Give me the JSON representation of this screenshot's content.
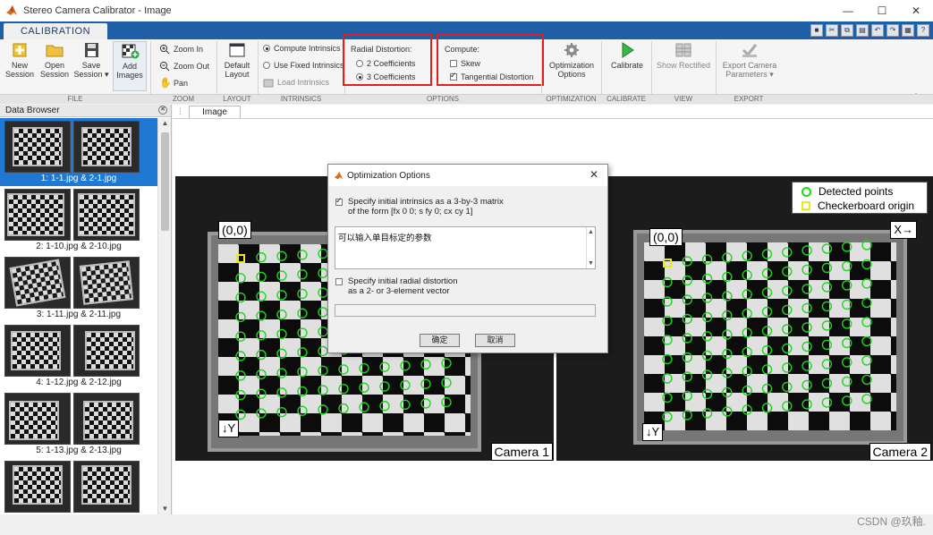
{
  "window": {
    "title": "Stereo Camera Calibrator - Image",
    "controls": [
      "—",
      "☐",
      "✕"
    ]
  },
  "tab": {
    "label": "CALIBRATION"
  },
  "ribbon": {
    "file": {
      "section": "FILE",
      "new_session": [
        "New",
        "Session"
      ],
      "open_session": [
        "Open",
        "Session"
      ],
      "save_session": [
        "Save",
        "Session ▾"
      ],
      "add_images": [
        "Add",
        "Images"
      ]
    },
    "zoom": {
      "section": "ZOOM",
      "zoom_in": "Zoom In",
      "zoom_out": "Zoom Out",
      "pan": "Pan"
    },
    "layout": {
      "section": "LAYOUT",
      "default_layout": [
        "Default",
        "Layout"
      ]
    },
    "intrinsics": {
      "section": "INTRINSICS",
      "compute": "Compute Intrinsics",
      "use_fixed": "Use Fixed Intrinsics",
      "load": "Load Intrinsics"
    },
    "options": {
      "section": "OPTIONS",
      "radial_title": "Radial Distortion:",
      "two_coeff": "2 Coefficients",
      "three_coeff": "3 Coefficients",
      "compute_title": "Compute:",
      "skew": "Skew",
      "tangential": "Tangential Distortion"
    },
    "optimization": {
      "section": "OPTIMIZATION",
      "options": [
        "Optimization",
        "Options"
      ]
    },
    "calibrate": {
      "section": "CALIBRATE",
      "label": "Calibrate"
    },
    "view": {
      "section": "VIEW",
      "show_rectified": "Show Rectified"
    },
    "export": {
      "section": "EXPORT",
      "export_camera": [
        "Export Camera",
        "Parameters ▾"
      ]
    }
  },
  "browser": {
    "title": "Data Browser",
    "items": [
      {
        "label": "1: 1-1.jpg & 2-1.jpg",
        "selected": true
      },
      {
        "label": "2: 1-10.jpg & 2-10.jpg",
        "selected": false
      },
      {
        "label": "3: 1-11.jpg & 2-11.jpg",
        "selected": false
      },
      {
        "label": "4: 1-12.jpg & 2-12.jpg",
        "selected": false
      },
      {
        "label": "5: 1-13.jpg & 2-13.jpg",
        "selected": false
      },
      {
        "label": "",
        "selected": false
      }
    ]
  },
  "image_panel": {
    "tab": "Image",
    "origin_label": "(0,0)",
    "y_axis_label": "↓Y",
    "x_axis_label": "X→",
    "camera1": "Camera 1",
    "camera2": "Camera 2",
    "legend": {
      "detected": "Detected points",
      "origin": "Checkerboard origin"
    }
  },
  "dialog": {
    "title": "Optimization Options",
    "option1": [
      "Specify initial intrinsics as a 3-by-3 matrix",
      "of the form [fx 0 0; s fy 0; cx cy 1]"
    ],
    "textarea": "可以输入单目标定的参数",
    "option2": [
      "Specify initial radial distortion",
      "as a 2- or 3-element vector"
    ],
    "ok": "确定",
    "cancel": "取消"
  },
  "watermark": "CSDN @玖釉.",
  "colors": {
    "accent": "#1e5fa8",
    "selection": "#1f78d1",
    "detected": "#1ed61e",
    "origin": "#e8e81a",
    "highlight": "#e02020"
  }
}
